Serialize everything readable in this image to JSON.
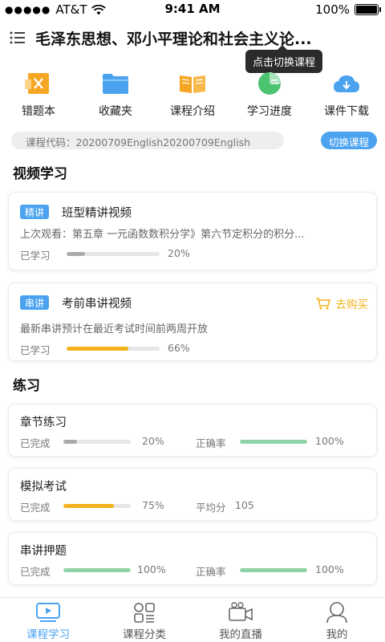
{
  "status_bar": {
    "carrier": "AT&T",
    "time": "9:41 AM",
    "battery": "100%"
  },
  "header": {
    "title": "毛泽东思想、邓小平理论和社会主义论..."
  },
  "tooltip": {
    "text": "点击切换课程"
  },
  "shortcuts": [
    {
      "label": "错题本",
      "icon": "wrong-notebook-icon",
      "color": "#f5a623"
    },
    {
      "label": "收藏夹",
      "icon": "folder-icon",
      "color": "#4ba3f0"
    },
    {
      "label": "课程介绍",
      "icon": "book-icon",
      "color": "#f5a623"
    },
    {
      "label": "学习进度",
      "icon": "pie-chart-icon",
      "color": "#4cc36e"
    },
    {
      "label": "课件下载",
      "icon": "cloud-download-icon",
      "color": "#4ba3f0"
    }
  ],
  "course_code": {
    "text": "课程代码：20200709English20200709English",
    "switch_label": "切换课程"
  },
  "video_section": {
    "title": "视频学习",
    "cards": [
      {
        "tag": "精讲",
        "name": "班型精讲视频",
        "sub": "上次观看：第五章 一元函数数积分学》第六节定积分的积分...",
        "progress_label": "已学习",
        "progress": 20,
        "progress_text": "20%"
      },
      {
        "tag": "串讲",
        "name": "考前串讲视频",
        "buy_label": "去购买",
        "sub": "最新串讲预计在最近考试时间前两周开放",
        "progress_label": "已学习",
        "progress": 66,
        "progress_text": "66%"
      }
    ]
  },
  "practice_section": {
    "title": "练习",
    "cards": [
      {
        "name": "章节练习",
        "left_label": "已完成",
        "left_value": 20,
        "left_text": "20%",
        "right_label": "正确率",
        "right_value": 100,
        "right_text": "100%"
      },
      {
        "name": "模拟考试",
        "left_label": "已完成",
        "left_value": 75,
        "left_text": "75%",
        "right_label": "平均分",
        "right_text": "105"
      },
      {
        "name": "串讲押题",
        "left_label": "已完成",
        "left_value": 100,
        "left_text": "100%",
        "right_label": "正确率",
        "right_value": 100,
        "right_text": "100%"
      }
    ]
  },
  "tabbar": [
    {
      "label": "课程学习",
      "icon": "video-lesson-icon",
      "active": true
    },
    {
      "label": "课程分类",
      "icon": "category-grid-icon",
      "active": false
    },
    {
      "label": "我的直播",
      "icon": "live-camera-icon",
      "active": false
    },
    {
      "label": "我的",
      "icon": "profile-icon",
      "active": false
    }
  ],
  "colors": {
    "accent": "#4ba3f0",
    "gray_bar": "#aaaaaa",
    "orange_bar": "#f3b21b",
    "green_bar": "#8fd3a7"
  }
}
